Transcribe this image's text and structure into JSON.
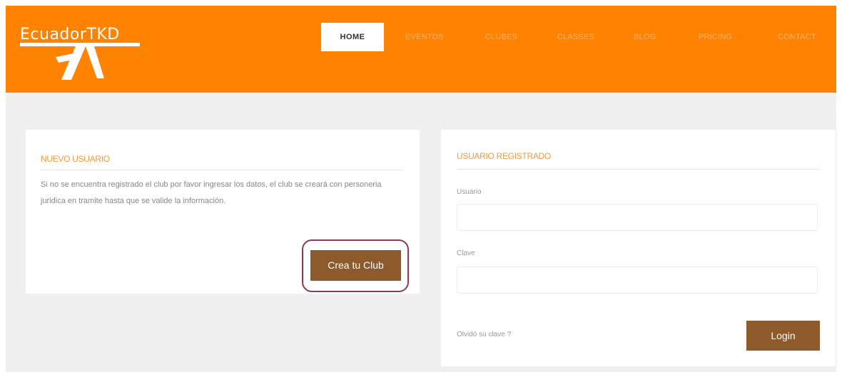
{
  "header": {
    "logo_text": "EcuadorTKD",
    "nav": [
      {
        "label": "HOME",
        "active": true
      },
      {
        "label": "EVENTOS"
      },
      {
        "label": "CLUBES"
      },
      {
        "label": "CLASSES"
      },
      {
        "label": "BLOG"
      },
      {
        "label": "PRICING"
      },
      {
        "label": "CONTACT"
      }
    ],
    "brand_color": "#ff8200"
  },
  "new_user": {
    "title": "NUEVO USUARIO",
    "description": "Si no se encuentra registrado el club por favor ingresar los datos, el club se creará con personeria juridica en tramite hasta que se valide la información.",
    "button_label": "Crea tu Club",
    "button_color": "#8e5a2c"
  },
  "registered_user": {
    "title": "USUARIO REGISTRADO",
    "username_label": "Usuario",
    "username_value": "",
    "password_label": "Clave",
    "password_value": "",
    "forgot_label": "Olvidó su clave ?",
    "login_label": "Login"
  }
}
